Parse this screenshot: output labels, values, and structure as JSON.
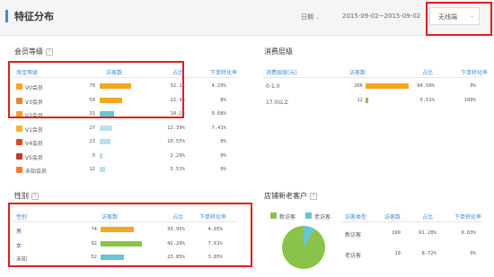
{
  "header": {
    "title": "特征分布",
    "date_label": "日期",
    "date_range": "2015-09-02~2015-09-02",
    "terminal_filter": "无线端"
  },
  "member_level": {
    "title": "会员等级",
    "help": "?",
    "columns": [
      "淘宝等级",
      "访客数",
      "占比",
      "下单转化率"
    ],
    "rows": [
      {
        "name": "V0会员",
        "visitors": "70",
        "share": "32.11",
        "conversion": "4.29%",
        "fill": 0.73,
        "icon": "v0-icon",
        "color": "#f5a623",
        "icon_color": "#f5a623"
      },
      {
        "name": "V3会员",
        "visitors": "50",
        "share": "22.94",
        "conversion": "8%",
        "fill": 0.53,
        "icon": "v3-icon",
        "color": "#f5a623",
        "icon_color": "#e8842a"
      },
      {
        "name": "V2会员",
        "visitors": "31",
        "share": "14.22",
        "conversion": "9.68%",
        "fill": 0.33,
        "icon": "v2-icon",
        "color": "#67c6d2",
        "icon_color": "#f0a030"
      },
      {
        "name": "V1会员",
        "visitors": "27",
        "share": "12.39%",
        "conversion": "7.41%",
        "fill": 0.29,
        "icon": "v1-icon",
        "color": "#b9e2e8",
        "icon_color": "#f5b335"
      },
      {
        "name": "V4会员",
        "visitors": "23",
        "share": "10.55%",
        "conversion": "0%",
        "fill": 0.25,
        "icon": "v4-icon",
        "color": "#b9e2e8",
        "icon_color": "#d64a2a"
      },
      {
        "name": "V5会员",
        "visitors": "5",
        "share": "2.29%",
        "conversion": "0%",
        "fill": 0.06,
        "icon": "v5-icon",
        "color": "#b9e2e8",
        "icon_color": "#c0392b"
      },
      {
        "name": "未知会员",
        "visitors": "12",
        "share": "5.51%",
        "conversion": "0%",
        "fill": 0.13,
        "icon": "unknown-member-icon",
        "color": "#b9e2e8",
        "icon_color": "#f07a3a"
      }
    ]
  },
  "spending": {
    "title": "消费层级",
    "columns": [
      "消费层级(元)",
      "访客数",
      "占比",
      "下单转化率"
    ],
    "rows": [
      {
        "name": "0-1.0",
        "visitors": "206",
        "share": "94.50%",
        "conversion": "0%",
        "fill": 0.95,
        "color": "#f5a623"
      },
      {
        "name": "17.0以上",
        "visitors": "12",
        "share": "5.51%",
        "conversion": "100%",
        "fill": 0.06,
        "color": "#8bc34a"
      }
    ]
  },
  "gender": {
    "title": "性别",
    "help": "?",
    "columns": [
      "性别",
      "访客数",
      "占比",
      "下单转化率"
    ],
    "rows": [
      {
        "name": "男",
        "visitors": "74",
        "share": "33.95%",
        "conversion": "4.05%",
        "fill": 0.8,
        "color": "#f5a623"
      },
      {
        "name": "女",
        "visitors": "92",
        "share": "42.20%",
        "conversion": "7.61%",
        "fill": 1.0,
        "color": "#8bc34a"
      },
      {
        "name": "未知",
        "visitors": "52",
        "share": "23.85%",
        "conversion": "3.85%",
        "fill": 0.57,
        "color": "#67c6d2"
      }
    ]
  },
  "new_old": {
    "title": "店铺新老客户",
    "help": "?",
    "legend": [
      {
        "label": "新访客",
        "color": "#8bc34a"
      },
      {
        "label": "老访客",
        "color": "#67c6d2"
      }
    ],
    "columns": [
      "访客类型",
      "访客数",
      "占比",
      "下单转化率"
    ],
    "rows": [
      {
        "name": "新访客",
        "visitors": "199",
        "share": "91.28%",
        "conversion": "6.03%"
      },
      {
        "name": "老访客",
        "visitors": "19",
        "share": "8.72%",
        "conversion": "0%"
      }
    ],
    "pie": {
      "new_fraction": 0.9128
    }
  }
}
